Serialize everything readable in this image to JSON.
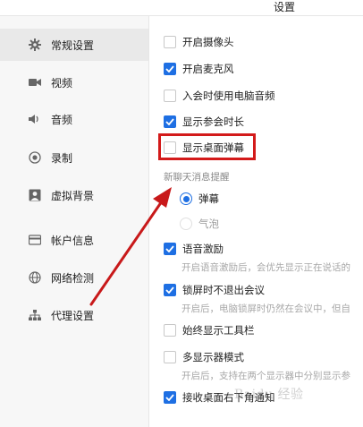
{
  "window": {
    "title": "设置"
  },
  "sidebar": {
    "items": [
      {
        "label": "常规设置",
        "icon": "gear-icon",
        "active": true
      },
      {
        "label": "视频",
        "icon": "camera-icon"
      },
      {
        "label": "音频",
        "icon": "speaker-icon"
      },
      {
        "label": "录制",
        "icon": "record-icon"
      },
      {
        "label": "虚拟背景",
        "icon": "portrait-icon"
      },
      {
        "label": "帐户信息",
        "icon": "id-card-icon"
      },
      {
        "label": "网络检测",
        "icon": "globe-icon"
      },
      {
        "label": "代理设置",
        "icon": "network-icon"
      }
    ]
  },
  "settings": {
    "camera": {
      "label": "开启摄像头",
      "checked": false
    },
    "mic": {
      "label": "开启麦克风",
      "checked": true
    },
    "computer_audio": {
      "label": "入会时使用电脑音频",
      "checked": false
    },
    "show_duration": {
      "label": "显示参会时长",
      "checked": true
    },
    "desktop_danmaku": {
      "label": "显示桌面弹幕",
      "checked": false
    },
    "chat_section_label": "新聊天消息提醒",
    "chat_options": [
      {
        "label": "弹幕",
        "selected": true
      },
      {
        "label": "气泡",
        "selected": false
      }
    ],
    "voice_incentive": {
      "label": "语音激励",
      "checked": true,
      "desc": "开启语音激励后，会优先显示正在说话的"
    },
    "lock_screen": {
      "label": "锁屏时不退出会议",
      "checked": true,
      "desc": "开启后，电脑锁屏时仍然在会议中，但自"
    },
    "toolbar": {
      "label": "始终显示工具栏",
      "checked": false
    },
    "multi_display": {
      "label": "多显示器模式",
      "checked": false,
      "desc": "开启后，支持在两个显示器中分别显示参"
    },
    "desktop_corner": {
      "label": "接收桌面右下角通知",
      "checked": true
    }
  },
  "watermark": "Baidu 经验",
  "colors": {
    "accent": "#1e6fe3",
    "annotation": "#d31a1a"
  }
}
